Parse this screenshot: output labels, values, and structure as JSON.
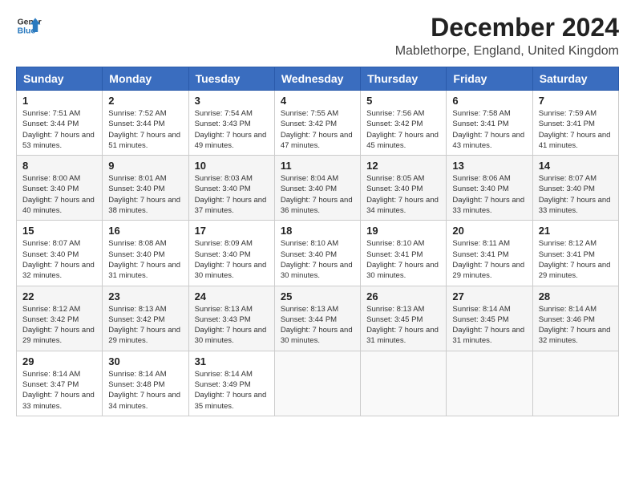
{
  "header": {
    "logo_line1": "General",
    "logo_line2": "Blue",
    "title": "December 2024",
    "subtitle": "Mablethorpe, England, United Kingdom"
  },
  "columns": [
    "Sunday",
    "Monday",
    "Tuesday",
    "Wednesday",
    "Thursday",
    "Friday",
    "Saturday"
  ],
  "weeks": [
    [
      {
        "day": "1",
        "sunrise": "7:51 AM",
        "sunset": "3:44 PM",
        "daylight": "7 hours and 53 minutes."
      },
      {
        "day": "2",
        "sunrise": "7:52 AM",
        "sunset": "3:44 PM",
        "daylight": "7 hours and 51 minutes."
      },
      {
        "day": "3",
        "sunrise": "7:54 AM",
        "sunset": "3:43 PM",
        "daylight": "7 hours and 49 minutes."
      },
      {
        "day": "4",
        "sunrise": "7:55 AM",
        "sunset": "3:42 PM",
        "daylight": "7 hours and 47 minutes."
      },
      {
        "day": "5",
        "sunrise": "7:56 AM",
        "sunset": "3:42 PM",
        "daylight": "7 hours and 45 minutes."
      },
      {
        "day": "6",
        "sunrise": "7:58 AM",
        "sunset": "3:41 PM",
        "daylight": "7 hours and 43 minutes."
      },
      {
        "day": "7",
        "sunrise": "7:59 AM",
        "sunset": "3:41 PM",
        "daylight": "7 hours and 41 minutes."
      }
    ],
    [
      {
        "day": "8",
        "sunrise": "8:00 AM",
        "sunset": "3:40 PM",
        "daylight": "7 hours and 40 minutes."
      },
      {
        "day": "9",
        "sunrise": "8:01 AM",
        "sunset": "3:40 PM",
        "daylight": "7 hours and 38 minutes."
      },
      {
        "day": "10",
        "sunrise": "8:03 AM",
        "sunset": "3:40 PM",
        "daylight": "7 hours and 37 minutes."
      },
      {
        "day": "11",
        "sunrise": "8:04 AM",
        "sunset": "3:40 PM",
        "daylight": "7 hours and 36 minutes."
      },
      {
        "day": "12",
        "sunrise": "8:05 AM",
        "sunset": "3:40 PM",
        "daylight": "7 hours and 34 minutes."
      },
      {
        "day": "13",
        "sunrise": "8:06 AM",
        "sunset": "3:40 PM",
        "daylight": "7 hours and 33 minutes."
      },
      {
        "day": "14",
        "sunrise": "8:07 AM",
        "sunset": "3:40 PM",
        "daylight": "7 hours and 33 minutes."
      }
    ],
    [
      {
        "day": "15",
        "sunrise": "8:07 AM",
        "sunset": "3:40 PM",
        "daylight": "7 hours and 32 minutes."
      },
      {
        "day": "16",
        "sunrise": "8:08 AM",
        "sunset": "3:40 PM",
        "daylight": "7 hours and 31 minutes."
      },
      {
        "day": "17",
        "sunrise": "8:09 AM",
        "sunset": "3:40 PM",
        "daylight": "7 hours and 30 minutes."
      },
      {
        "day": "18",
        "sunrise": "8:10 AM",
        "sunset": "3:40 PM",
        "daylight": "7 hours and 30 minutes."
      },
      {
        "day": "19",
        "sunrise": "8:10 AM",
        "sunset": "3:41 PM",
        "daylight": "7 hours and 30 minutes."
      },
      {
        "day": "20",
        "sunrise": "8:11 AM",
        "sunset": "3:41 PM",
        "daylight": "7 hours and 29 minutes."
      },
      {
        "day": "21",
        "sunrise": "8:12 AM",
        "sunset": "3:41 PM",
        "daylight": "7 hours and 29 minutes."
      }
    ],
    [
      {
        "day": "22",
        "sunrise": "8:12 AM",
        "sunset": "3:42 PM",
        "daylight": "7 hours and 29 minutes."
      },
      {
        "day": "23",
        "sunrise": "8:13 AM",
        "sunset": "3:42 PM",
        "daylight": "7 hours and 29 minutes."
      },
      {
        "day": "24",
        "sunrise": "8:13 AM",
        "sunset": "3:43 PM",
        "daylight": "7 hours and 30 minutes."
      },
      {
        "day": "25",
        "sunrise": "8:13 AM",
        "sunset": "3:44 PM",
        "daylight": "7 hours and 30 minutes."
      },
      {
        "day": "26",
        "sunrise": "8:13 AM",
        "sunset": "3:45 PM",
        "daylight": "7 hours and 31 minutes."
      },
      {
        "day": "27",
        "sunrise": "8:14 AM",
        "sunset": "3:45 PM",
        "daylight": "7 hours and 31 minutes."
      },
      {
        "day": "28",
        "sunrise": "8:14 AM",
        "sunset": "3:46 PM",
        "daylight": "7 hours and 32 minutes."
      }
    ],
    [
      {
        "day": "29",
        "sunrise": "8:14 AM",
        "sunset": "3:47 PM",
        "daylight": "7 hours and 33 minutes."
      },
      {
        "day": "30",
        "sunrise": "8:14 AM",
        "sunset": "3:48 PM",
        "daylight": "7 hours and 34 minutes."
      },
      {
        "day": "31",
        "sunrise": "8:14 AM",
        "sunset": "3:49 PM",
        "daylight": "7 hours and 35 minutes."
      },
      null,
      null,
      null,
      null
    ]
  ]
}
